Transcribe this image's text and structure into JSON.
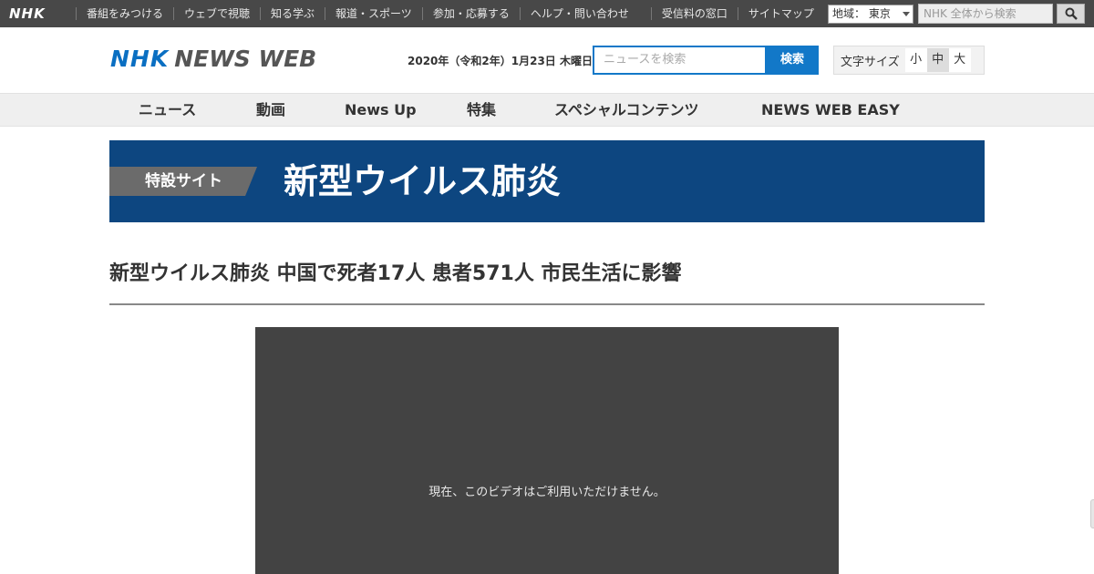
{
  "global_bar": {
    "logo": "NHK",
    "links": [
      "番組をみつける",
      "ウェブで視聴",
      "知る学ぶ",
      "報道・スポーツ",
      "参加・応募する",
      "ヘルプ・問い合わせ",
      "",
      "受信料の窓口",
      "サイトマップ"
    ],
    "region_label": "地域： 東京",
    "search_placeholder": "NHK 全体から検索"
  },
  "header": {
    "logo_nhk": "NHK",
    "logo_newsweb": "NEWS WEB",
    "date": "2020年（令和2年）1月23日 木曜日",
    "search_placeholder": "ニュースを検索",
    "search_button": "検索",
    "fontsize_label": "文字サイズ",
    "fontsize_small": "小",
    "fontsize_medium": "中",
    "fontsize_large": "大"
  },
  "nav": {
    "items": [
      "ニュース",
      "動画",
      "News Up",
      "特集",
      "スペシャルコンテンツ",
      "NEWS WEB EASY"
    ]
  },
  "banner": {
    "tag": "特設サイト",
    "title": "新型ウイルス肺炎"
  },
  "article": {
    "headline": "新型ウイルス肺炎 中国で死者17人 患者571人 市民生活に影響",
    "video_message": "現在、このビデオはご利用いただけません。"
  },
  "colors": {
    "global_bar_bg": "#484848",
    "brand_blue": "#1278c8",
    "banner_bg": "#0d4680",
    "video_bg": "#434343"
  }
}
